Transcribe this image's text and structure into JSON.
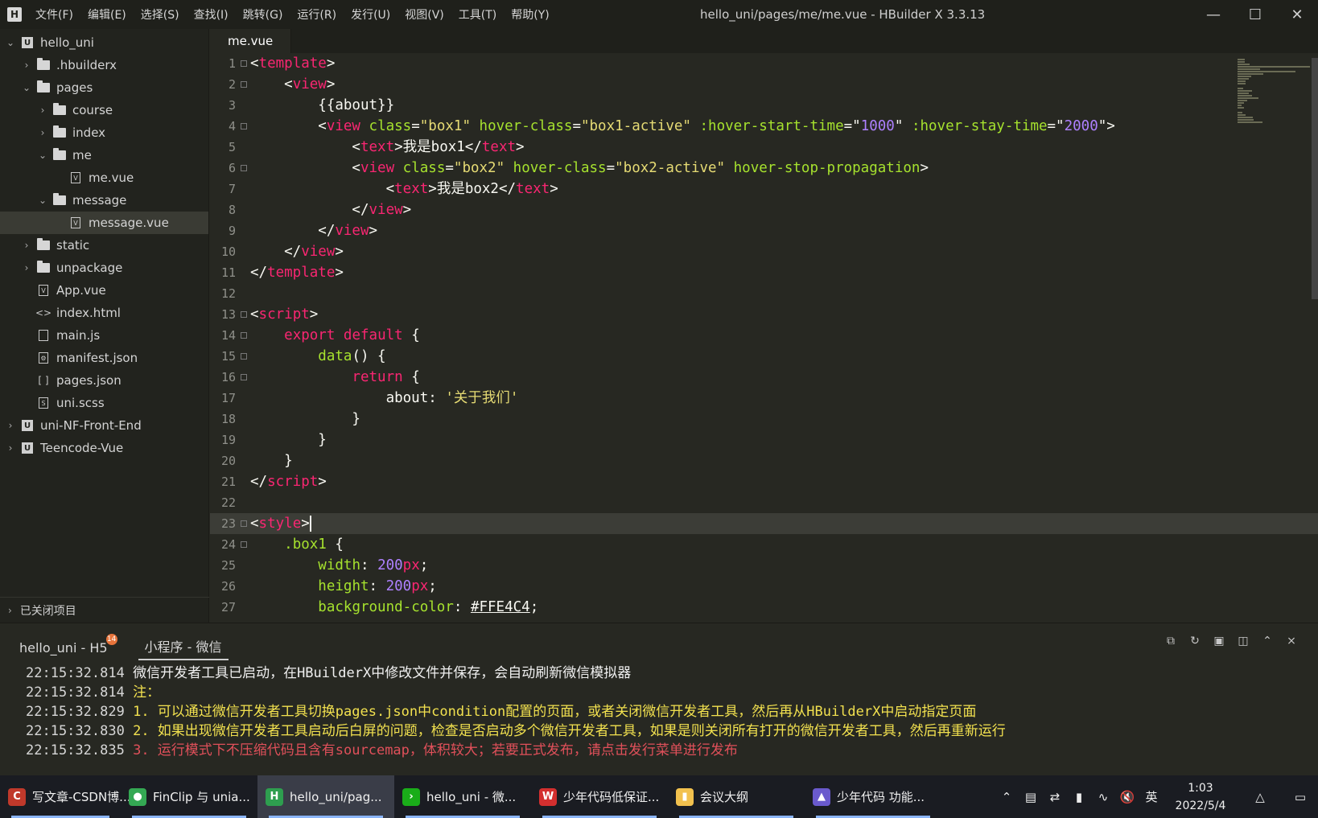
{
  "titlebar": {
    "menu": [
      "文件(F)",
      "编辑(E)",
      "选择(S)",
      "查找(I)",
      "跳转(G)",
      "运行(R)",
      "发行(U)",
      "视图(V)",
      "工具(T)",
      "帮助(Y)"
    ],
    "title": "hello_uni/pages/me/me.vue - HBuilder X 3.3.13"
  },
  "sidebar": {
    "items": [
      {
        "label": "hello_uni",
        "depth": 0,
        "icon": "project-icon",
        "chevron": "down"
      },
      {
        "label": ".hbuilderx",
        "depth": 1,
        "icon": "folder-icon",
        "chevron": "right"
      },
      {
        "label": "pages",
        "depth": 1,
        "icon": "folder-open-icon",
        "chevron": "down"
      },
      {
        "label": "course",
        "depth": 2,
        "icon": "folder-icon",
        "chevron": "right"
      },
      {
        "label": "index",
        "depth": 2,
        "icon": "folder-icon",
        "chevron": "right"
      },
      {
        "label": "me",
        "depth": 2,
        "icon": "folder-open-icon",
        "chevron": "down"
      },
      {
        "label": "me.vue",
        "depth": 3,
        "icon": "vue-file-icon",
        "chevron": ""
      },
      {
        "label": "message",
        "depth": 2,
        "icon": "folder-open-icon",
        "chevron": "down"
      },
      {
        "label": "message.vue",
        "depth": 3,
        "icon": "vue-file-icon",
        "chevron": "",
        "selected": true
      },
      {
        "label": "static",
        "depth": 1,
        "icon": "folder-icon",
        "chevron": "right"
      },
      {
        "label": "unpackage",
        "depth": 1,
        "icon": "folder-icon",
        "chevron": "right"
      },
      {
        "label": "App.vue",
        "depth": 1,
        "icon": "vue-file-icon",
        "chevron": ""
      },
      {
        "label": "index.html",
        "depth": 1,
        "icon": "html-file-icon",
        "chevron": ""
      },
      {
        "label": "main.js",
        "depth": 1,
        "icon": "js-file-icon",
        "chevron": ""
      },
      {
        "label": "manifest.json",
        "depth": 1,
        "icon": "manifest-file-icon",
        "chevron": ""
      },
      {
        "label": "pages.json",
        "depth": 1,
        "icon": "json-file-icon",
        "chevron": ""
      },
      {
        "label": "uni.scss",
        "depth": 1,
        "icon": "scss-file-icon",
        "chevron": ""
      },
      {
        "label": "uni-NF-Front-End",
        "depth": 0,
        "icon": "project-icon",
        "chevron": "right"
      },
      {
        "label": "Teencode-Vue",
        "depth": 0,
        "icon": "project-icon",
        "chevron": "right"
      }
    ],
    "closed_projects": "已关闭项目"
  },
  "editor": {
    "tab": "me.vue",
    "current_line": 23,
    "lines": [
      {
        "n": "1",
        "fold": true,
        "tokens": [
          [
            "p",
            "<"
          ],
          [
            "t",
            "template"
          ],
          [
            "p",
            ">"
          ]
        ]
      },
      {
        "n": "2",
        "fold": true,
        "tokens": [
          [
            "p",
            "    <"
          ],
          [
            "t",
            "view"
          ],
          [
            "p",
            ">"
          ]
        ]
      },
      {
        "n": "3",
        "fold": false,
        "tokens": [
          [
            "p",
            "        {{about}}"
          ]
        ]
      },
      {
        "n": "4",
        "fold": true,
        "tokens": [
          [
            "p",
            "        <"
          ],
          [
            "t",
            "view"
          ],
          [
            "p",
            " "
          ],
          [
            "a",
            "class"
          ],
          [
            "p",
            "="
          ],
          [
            "s",
            "\"box1\""
          ],
          [
            "p",
            " "
          ],
          [
            "a",
            "hover-class"
          ],
          [
            "p",
            "="
          ],
          [
            "s",
            "\"box1-active\""
          ],
          [
            "p",
            " "
          ],
          [
            "a",
            ":hover-start-time"
          ],
          [
            "p",
            "=\""
          ],
          [
            "n",
            "1000"
          ],
          [
            "p",
            "\" "
          ],
          [
            "a",
            ":hover-stay-time"
          ],
          [
            "p",
            "=\""
          ],
          [
            "n",
            "2000"
          ],
          [
            "p",
            "\">"
          ]
        ]
      },
      {
        "n": "5",
        "fold": false,
        "tokens": [
          [
            "p",
            "            <"
          ],
          [
            "t",
            "text"
          ],
          [
            "p",
            ">我是box1</"
          ],
          [
            "t",
            "text"
          ],
          [
            "p",
            ">"
          ]
        ]
      },
      {
        "n": "6",
        "fold": true,
        "tokens": [
          [
            "p",
            "            <"
          ],
          [
            "t",
            "view"
          ],
          [
            "p",
            " "
          ],
          [
            "a",
            "class"
          ],
          [
            "p",
            "="
          ],
          [
            "s",
            "\"box2\""
          ],
          [
            "p",
            " "
          ],
          [
            "a",
            "hover-class"
          ],
          [
            "p",
            "="
          ],
          [
            "s",
            "\"box2-active\""
          ],
          [
            "p",
            " "
          ],
          [
            "a",
            "hover-stop-propagation"
          ],
          [
            "p",
            ">"
          ]
        ]
      },
      {
        "n": "7",
        "fold": false,
        "tokens": [
          [
            "p",
            "                <"
          ],
          [
            "t",
            "text"
          ],
          [
            "p",
            ">我是box2</"
          ],
          [
            "t",
            "text"
          ],
          [
            "p",
            ">"
          ]
        ]
      },
      {
        "n": "8",
        "fold": false,
        "tokens": [
          [
            "p",
            "            </"
          ],
          [
            "t",
            "view"
          ],
          [
            "p",
            ">"
          ]
        ]
      },
      {
        "n": "9",
        "fold": false,
        "tokens": [
          [
            "p",
            "        </"
          ],
          [
            "t",
            "view"
          ],
          [
            "p",
            ">"
          ]
        ]
      },
      {
        "n": "10",
        "fold": false,
        "tokens": [
          [
            "p",
            "    </"
          ],
          [
            "t",
            "view"
          ],
          [
            "p",
            ">"
          ]
        ]
      },
      {
        "n": "11",
        "fold": false,
        "tokens": [
          [
            "p",
            "</"
          ],
          [
            "t",
            "template"
          ],
          [
            "p",
            ">"
          ]
        ]
      },
      {
        "n": "12",
        "fold": false,
        "tokens": []
      },
      {
        "n": "13",
        "fold": true,
        "tokens": [
          [
            "p",
            "<"
          ],
          [
            "t",
            "script"
          ],
          [
            "p",
            ">"
          ]
        ]
      },
      {
        "n": "14",
        "fold": true,
        "tokens": [
          [
            "p",
            "    "
          ],
          [
            "t",
            "export"
          ],
          [
            "p",
            " "
          ],
          [
            "t",
            "default"
          ],
          [
            "p",
            " {"
          ]
        ]
      },
      {
        "n": "15",
        "fold": true,
        "tokens": [
          [
            "p",
            "        "
          ],
          [
            "a",
            "data"
          ],
          [
            "p",
            "() {"
          ]
        ]
      },
      {
        "n": "16",
        "fold": true,
        "tokens": [
          [
            "p",
            "            "
          ],
          [
            "t",
            "return"
          ],
          [
            "p",
            " {"
          ]
        ]
      },
      {
        "n": "17",
        "fold": false,
        "tokens": [
          [
            "p",
            "                about: "
          ],
          [
            "s",
            "'关于我们'"
          ]
        ]
      },
      {
        "n": "18",
        "fold": false,
        "tokens": [
          [
            "p",
            "            }"
          ]
        ]
      },
      {
        "n": "19",
        "fold": false,
        "tokens": [
          [
            "p",
            "        }"
          ]
        ]
      },
      {
        "n": "20",
        "fold": false,
        "tokens": [
          [
            "p",
            "    }"
          ]
        ]
      },
      {
        "n": "21",
        "fold": false,
        "tokens": [
          [
            "p",
            "</"
          ],
          [
            "t",
            "script"
          ],
          [
            "p",
            ">"
          ]
        ]
      },
      {
        "n": "22",
        "fold": false,
        "tokens": []
      },
      {
        "n": "23",
        "fold": true,
        "tokens": [
          [
            "p",
            "<"
          ],
          [
            "t",
            "style"
          ],
          [
            "p",
            ">"
          ]
        ]
      },
      {
        "n": "24",
        "fold": true,
        "tokens": [
          [
            "p",
            "    "
          ],
          [
            "a",
            ".box1"
          ],
          [
            "p",
            " {"
          ]
        ]
      },
      {
        "n": "25",
        "fold": false,
        "tokens": [
          [
            "p",
            "        "
          ],
          [
            "a",
            "width"
          ],
          [
            "p",
            ": "
          ],
          [
            "n",
            "200"
          ],
          [
            "t",
            "px"
          ],
          [
            "p",
            ";"
          ]
        ]
      },
      {
        "n": "26",
        "fold": false,
        "tokens": [
          [
            "p",
            "        "
          ],
          [
            "a",
            "height"
          ],
          [
            "p",
            ": "
          ],
          [
            "n",
            "200"
          ],
          [
            "t",
            "px"
          ],
          [
            "p",
            ";"
          ]
        ]
      },
      {
        "n": "27",
        "fold": false,
        "tokens": [
          [
            "p",
            "        "
          ],
          [
            "a",
            "background-color"
          ],
          [
            "p",
            ": "
          ],
          [
            "h",
            "#FFE4C4"
          ],
          [
            "p",
            ";"
          ]
        ]
      }
    ]
  },
  "console": {
    "tabs": [
      "hello_uni - H5",
      "小程序 - 微信"
    ],
    "badge": "14",
    "logs": [
      {
        "time": "22:15:32.814",
        "text": "微信开发者工具已启动，在HBuilderX中修改文件并保存，会自动刷新微信模拟器",
        "color": "white"
      },
      {
        "time": "22:15:32.814",
        "text": "注：",
        "color": "yellow"
      },
      {
        "time": "22:15:32.829",
        "text": "1. 可以通过微信开发者工具切换pages.json中condition配置的页面，或者关闭微信开发者工具，然后再从HBuilderX中启动指定页面",
        "color": "yellow"
      },
      {
        "time": "22:15:32.830",
        "text": "2. 如果出现微信开发者工具启动后白屏的问题，检查是否启动多个微信开发者工具，如果是则关闭所有打开的微信开发者工具，然后再重新运行",
        "color": "yellow"
      },
      {
        "time": "22:15:32.835",
        "text": "3. 运行模式下不压缩代码且含有sourcemap，体积较大；若要正式发布，请点击发行菜单进行发布",
        "color": "red"
      }
    ]
  },
  "taskbar": {
    "tasks": [
      {
        "label": "写文章-CSDN博...",
        "icon": "csdn-icon",
        "color": "#c0392b"
      },
      {
        "label": "FinClip 与 unia...",
        "icon": "chrome-icon",
        "color": "#34a853"
      },
      {
        "label": "hello_uni/pag...",
        "icon": "hbuilder-icon",
        "color": "#2e9e4f",
        "active": true
      },
      {
        "label": "hello_uni - 微...",
        "icon": "wechat-devtools-icon",
        "color": "#1aad19"
      },
      {
        "label": "少年代码低保证...",
        "icon": "wps-icon",
        "color": "#d32f2f"
      },
      {
        "label": "会议大纲",
        "icon": "folder-icon",
        "color": "#f2c14e"
      },
      {
        "label": "少年代码 功能...",
        "icon": "mountain-icon",
        "color": "#6a5acd"
      }
    ],
    "tray": {
      "ime": "英",
      "time": "1:03",
      "date": "2022/5/4"
    }
  }
}
